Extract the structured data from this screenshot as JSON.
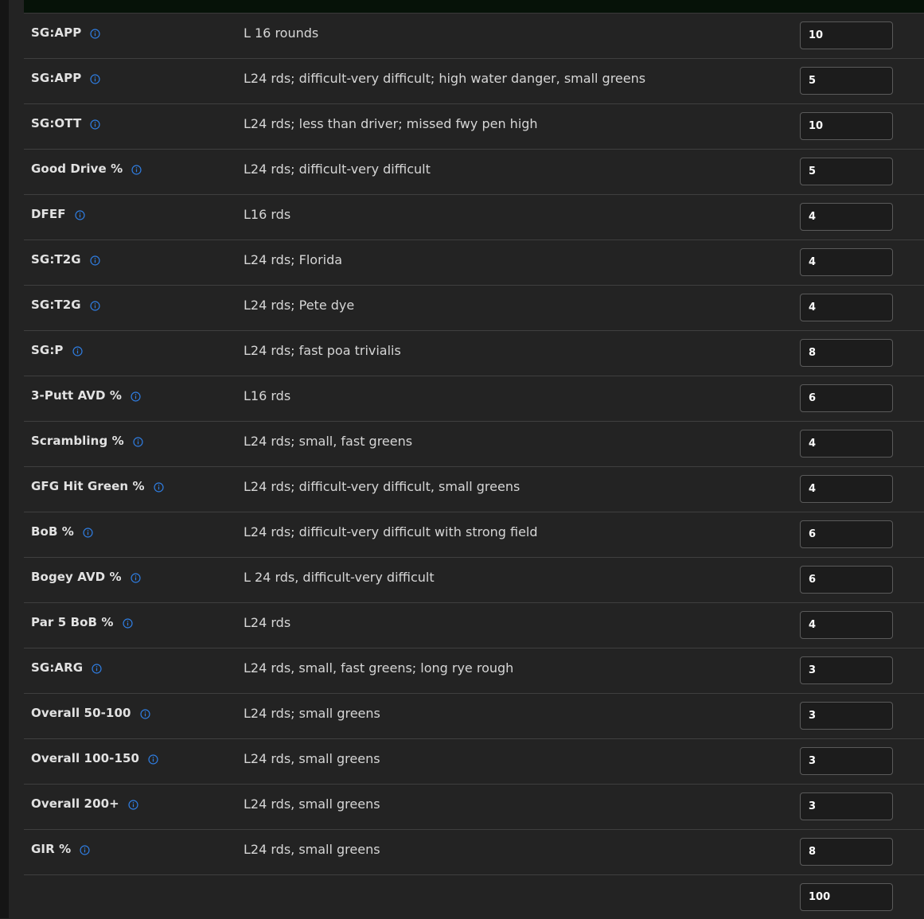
{
  "rows": [
    {
      "stat": "SG:APP",
      "description": "L 16 rounds",
      "weight": "10"
    },
    {
      "stat": "SG:APP",
      "description": "L24 rds; difficult-very difficult; high water danger, small greens",
      "weight": "5"
    },
    {
      "stat": "SG:OTT",
      "description": "L24 rds; less than driver; missed fwy pen high",
      "weight": "10"
    },
    {
      "stat": "Good Drive %",
      "description": "L24 rds; difficult-very difficult",
      "weight": "5"
    },
    {
      "stat": "DFEF",
      "description": "L16 rds",
      "weight": "4"
    },
    {
      "stat": "SG:T2G",
      "description": "L24 rds; Florida",
      "weight": "4"
    },
    {
      "stat": "SG:T2G",
      "description": "L24 rds; Pete dye",
      "weight": "4"
    },
    {
      "stat": "SG:P",
      "description": "L24 rds; fast poa trivialis",
      "weight": "8"
    },
    {
      "stat": "3-Putt AVD %",
      "description": "L16 rds",
      "weight": "6"
    },
    {
      "stat": "Scrambling %",
      "description": "L24 rds; small, fast greens",
      "weight": "4"
    },
    {
      "stat": "GFG Hit Green %",
      "description": "L24 rds; difficult-very difficult, small greens",
      "weight": "4"
    },
    {
      "stat": "BoB %",
      "description": "L24 rds; difficult-very difficult with strong field",
      "weight": "6"
    },
    {
      "stat": "Bogey AVD %",
      "description": "L 24 rds, difficult-very difficult",
      "weight": "6"
    },
    {
      "stat": "Par 5 BoB %",
      "description": "L24 rds",
      "weight": "4"
    },
    {
      "stat": "SG:ARG",
      "description": "L24 rds, small, fast greens; long rye rough",
      "weight": "3"
    },
    {
      "stat": "Overall 50-100",
      "description": "L24 rds; small greens",
      "weight": "3"
    },
    {
      "stat": "Overall 100-150",
      "description": "L24 rds, small greens",
      "weight": "3"
    },
    {
      "stat": "Overall 200+",
      "description": "L24 rds, small greens",
      "weight": "3"
    },
    {
      "stat": "GIR %",
      "description": "L24 rds, small greens",
      "weight": "8"
    }
  ],
  "total": "100",
  "icons": {
    "info": "info-circle-icon"
  },
  "colors": {
    "info_icon": "#2f7de1",
    "background": "#232323",
    "top_bar": "#061208"
  }
}
